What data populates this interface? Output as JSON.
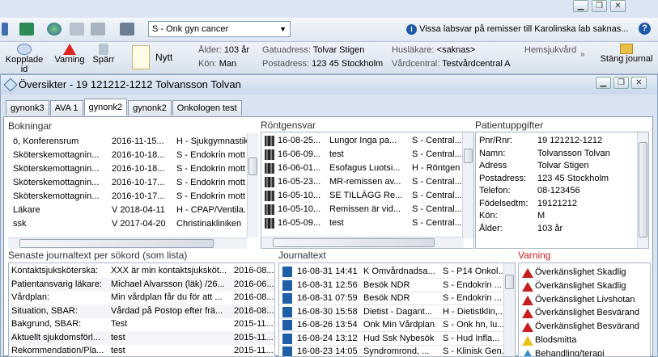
{
  "window_controls": {
    "minimize": "▁",
    "restore": "❐",
    "close": "✕"
  },
  "toolbar": {
    "clinic_selected": "S - Onk gyn cancer",
    "info_message": "Vissa labsvar på remisser till Karolinska lab saknas...",
    "help_label": "?"
  },
  "patient_header": {
    "kopplade_id": "Kopplade id",
    "varning": "Varning",
    "sparr": "Spärr",
    "nytt": "Nytt",
    "alder_label": "Ålder:",
    "alder_value": "103 år",
    "kon_label": "Kön:",
    "kon_value": "Man",
    "gatuadress_label": "Gatuadress:",
    "gatuadress_value": "Tolvar Stigen",
    "postadress_label": "Postadress:",
    "postadress_value": "123 45 Stockholm",
    "huslakare_label": "Husläkare:",
    "huslakare_value": "<saknas>",
    "vardcentral_label": "Vårdcentral:",
    "vardcentral_value": "Testvårdcentral A",
    "hemsjukvard_label": "Hemsjukvård",
    "stang_journal": "Stäng journal"
  },
  "window": {
    "title": "Översikter - 19 121212-1212 Tolvansson Tolvan",
    "tabs": [
      "gynonk3",
      "AVA 1",
      "gynonk2",
      "gynonk2",
      "Onkologen test"
    ]
  },
  "bokningar": {
    "title": "Bokningar",
    "rows": [
      [
        "ö, Konferensrum",
        "2016-11-15...",
        "H - Sjukgymnastik"
      ],
      [
        "Sköterskemottagnin...",
        "2016-10-18...",
        "S - Endokrin mott"
      ],
      [
        "Sköterskemottagnin...",
        "2016-10-18...",
        "S - Endokrin mott"
      ],
      [
        "Sköterskemottagnin...",
        "2016-10-17...",
        "S - Endokrin mott"
      ],
      [
        "Sköterskemottagnin...",
        "2016-10-17...",
        "S - Endokrin mott"
      ],
      [
        "Läkare",
        "V 2018-04-11",
        "H - CPAP/Ventila..."
      ],
      [
        "ssk",
        "V 2017-04-20",
        "Christinakliniken"
      ]
    ]
  },
  "rontgensvar": {
    "title": "Röntgensvar",
    "rows": [
      [
        "16-08-25...",
        "Lungor Inga pa...",
        "S - Central..."
      ],
      [
        "16-06-09...",
        "test",
        "S - Central..."
      ],
      [
        "16-06-01...",
        "Esofagus Luotsi...",
        "H - Röntgen"
      ],
      [
        "16-05-23...",
        "MR-remissen av...",
        "S - Central..."
      ],
      [
        "16-05-10...",
        "SE TILLÄGG Re...",
        "S - Central..."
      ],
      [
        "16-05-10...",
        "Remissen är vid...",
        "S - Central..."
      ],
      [
        "16-05-09...",
        "test",
        "S - Central..."
      ]
    ]
  },
  "patientuppgifter": {
    "title": "Patientuppgifter",
    "rows": [
      [
        "Pnr/Rnr:",
        "19  121212-1212"
      ],
      [
        "Namn:",
        "Tolvansson Tolvan"
      ],
      [
        "Adress",
        "Tolvar Stigen"
      ],
      [
        "Postadress:",
        "123 45 Stockholm"
      ],
      [
        "Telefon:",
        "08-123456"
      ],
      [
        "Födelsedtm:",
        "19121212"
      ],
      [
        "Kön:",
        "M"
      ],
      [
        "Ålder:",
        "103 år"
      ]
    ]
  },
  "journaltext_lista": {
    "title": "Senaste journaltext per sökord (som lista)",
    "rows": [
      [
        "Kontaktsjuksköterska:",
        "XXX är min kontaktsjuksköt...",
        "2016-08..."
      ],
      [
        "Patientansvarig läkare:",
        "Michael Alvarsson (läk) /26...",
        "2016-06..."
      ],
      [
        "Vårdplan:",
        "Min vårdplan får du för att ...",
        "2016-08..."
      ],
      [
        "Situation, SBAR:",
        "Vårdad på Postop efter frä...",
        "2016-08..."
      ],
      [
        "Bakgrund, SBAR:",
        "Test",
        "2015-11..."
      ],
      [
        "Aktuellt sjukdomsförl...",
        "test",
        "2015-11..."
      ],
      [
        "Rekommendation/Pla...",
        "test",
        "2015-11..."
      ]
    ]
  },
  "journaltext": {
    "title": "Journaltext",
    "rows": [
      [
        "16-08-31 14:41",
        "K Omvårdnadsa...",
        "S - P14 Onkol..."
      ],
      [
        "16-08-31 12:56",
        "Besök NDR",
        "S - Endokrin ..."
      ],
      [
        "16-08-31 07:59",
        "Besök NDR",
        "S - Endokrin ..."
      ],
      [
        "16-08-30 15:58",
        "Dietist - Dagant...",
        "H - Dietistklin,..."
      ],
      [
        "16-08-26 13:54",
        "Onk Min Vårdplan",
        "S - Onk hn, lu..."
      ],
      [
        "16-08-24 13:12",
        "Hud Ssk Nybesök",
        "S - Hud Infla..."
      ],
      [
        "16-08-23 14:05",
        "Syndromrond, ...",
        "S - Klinisk Gen..."
      ]
    ]
  },
  "varning": {
    "title": "Varning",
    "title_color": "#c81e1e",
    "rows": [
      {
        "label": "Överkänslighet Skadlig",
        "icon": "red-warning-icon"
      },
      {
        "label": "Överkänslighet Skadlig",
        "icon": "red-warning-icon"
      },
      {
        "label": "Överkänslighet Livshotan",
        "icon": "red-warning-icon"
      },
      {
        "label": "Överkänslighet Besvärand",
        "icon": "red-warning-icon"
      },
      {
        "label": "Överkänslighet Besvärand",
        "icon": "red-warning-icon"
      },
      {
        "label": "Blodsmitta",
        "icon": "yellow-warning-icon"
      },
      {
        "label": "Behandling/terapi",
        "icon": "blue-warning-icon"
      }
    ]
  }
}
